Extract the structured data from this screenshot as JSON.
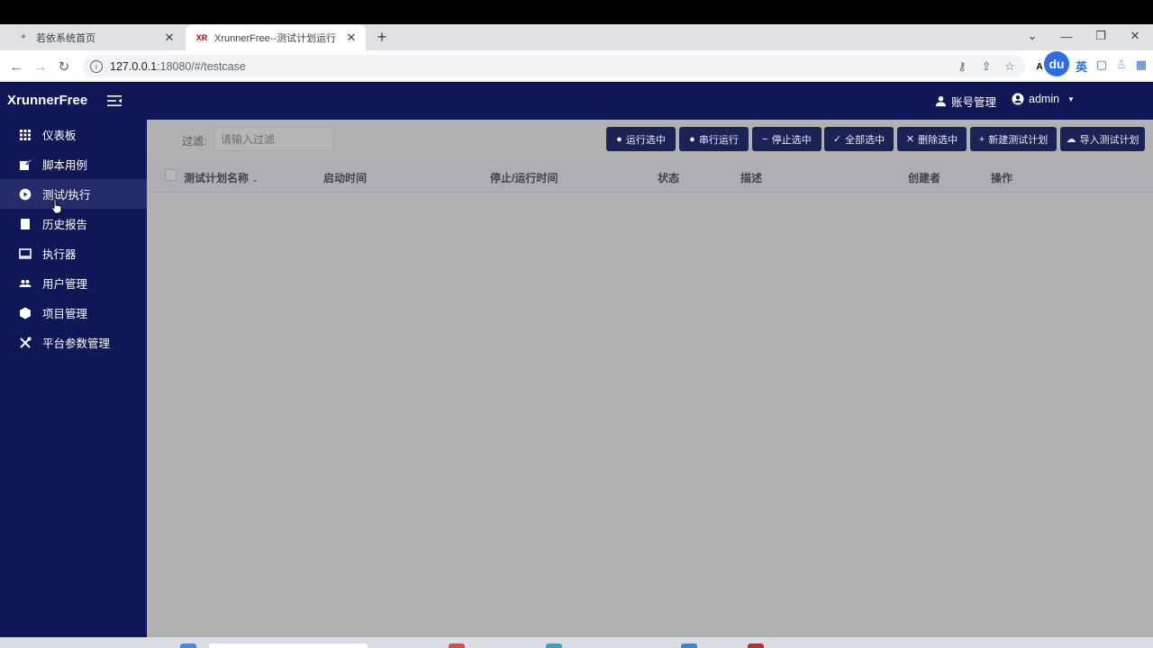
{
  "browser": {
    "tabs": [
      {
        "title": "若依系统首页",
        "active": false
      },
      {
        "title": "XrunnerFree--测试计划运行",
        "active": true
      }
    ],
    "url_host": "127.0.0.1",
    "url_rest": ":18080/#/testcase",
    "ext_du": "du",
    "ext_ying": "英"
  },
  "app": {
    "brand": "XrunnerFree",
    "header": {
      "account": "账号管理",
      "user": "admin"
    },
    "sidebar": [
      {
        "label": "仪表板",
        "icon": "grid-icon"
      },
      {
        "label": "脚本用例",
        "icon": "edit-icon"
      },
      {
        "label": "测试/执行",
        "icon": "play-circle-icon",
        "active": true
      },
      {
        "label": "历史报告",
        "icon": "book-icon"
      },
      {
        "label": "执行器",
        "icon": "monitor-icon"
      },
      {
        "label": "用户管理",
        "icon": "users-icon"
      },
      {
        "label": "项目管理",
        "icon": "cube-icon"
      },
      {
        "label": "平台参数管理",
        "icon": "tools-icon"
      }
    ],
    "filter": {
      "label": "过滤:",
      "placeholder": "请输入过滤"
    },
    "buttons": [
      {
        "label": "运行选中",
        "icon": "clock-icon"
      },
      {
        "label": "串行运行",
        "icon": "clock-icon"
      },
      {
        "label": "停止选中",
        "icon": "minus-icon"
      },
      {
        "label": "全部选中",
        "icon": "check-icon"
      },
      {
        "label": "删除选中",
        "icon": "x-icon"
      },
      {
        "label": "新建测试计划",
        "icon": "plus-icon"
      },
      {
        "label": "导入测试计划",
        "icon": "cloud-upload-icon"
      }
    ],
    "columns": [
      "测试计划名称",
      "启动时间",
      "停止/运行时间",
      "状态",
      "描述",
      "创建者",
      "操作"
    ]
  }
}
